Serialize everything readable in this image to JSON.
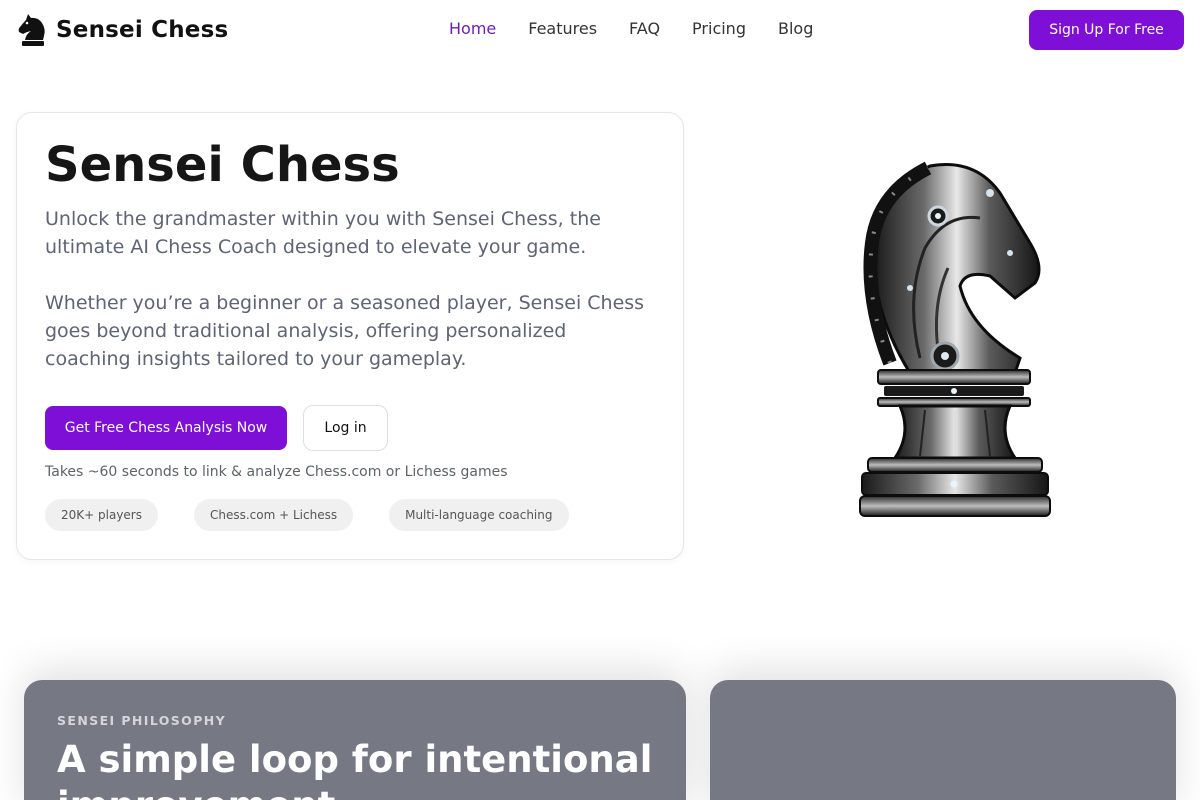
{
  "header": {
    "brand": "Sensei Chess",
    "brand_icon": "knight-icon",
    "nav": [
      "Home",
      "Features",
      "FAQ",
      "Pricing",
      "Blog"
    ],
    "active_nav": "Home",
    "signup_label": "Sign Up For Free"
  },
  "hero": {
    "title": "Sensei Chess",
    "paragraph1": "Unlock the grandmaster within you with Sensei Chess, the ultimate AI Chess Coach designed to elevate your game.",
    "paragraph2": "Whether you’re a beginner or a seasoned player, Sensei Chess goes beyond traditional analysis, offering personalized coaching insights tailored to your gameplay.",
    "cta_label": "Get Free Chess Analysis Now",
    "login_label": "Log in",
    "note": "Takes ~60 seconds to link & analyze Chess.com or Lichess games",
    "pills": [
      "20K+ players",
      "Chess.com + Lichess",
      "Multi-language coaching"
    ]
  },
  "illustration": {
    "icon": "robotic-knight-chess-piece"
  },
  "philosophy": {
    "eyebrow": "SENSEI PHILOSOPHY",
    "title": "A simple loop for intentional improvement"
  },
  "colors": {
    "accent": "#7e0fd6",
    "nav_active": "#6b1fb0",
    "card_gray": "#767983"
  }
}
